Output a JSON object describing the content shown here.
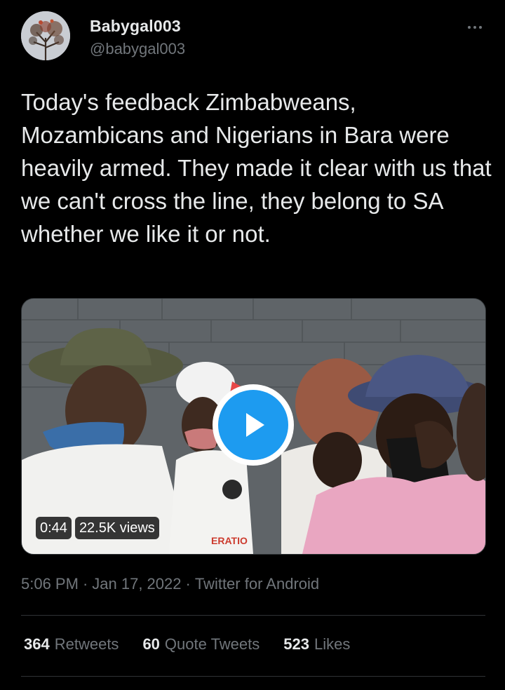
{
  "author": {
    "display_name": "Babygal003",
    "handle": "@babygal003",
    "avatar_icon": "avatar-tree-photo"
  },
  "more_icon": "ellipsis-icon",
  "tweet": {
    "text": "Today's feedback Zimbabweans, Mozambicans and Nigerians in Bara were heavily armed. They made it clear with us that we can't cross the line, they belong to SA whether we like it or not."
  },
  "video": {
    "duration": "0:44",
    "views": "22.5K views",
    "play_icon": "play-icon"
  },
  "meta": {
    "time": "5:06 PM",
    "date": "Jan 17, 2022",
    "source": "Twitter for Android",
    "separator": "·"
  },
  "stats": {
    "retweets_count": "364",
    "retweets_label": "Retweets",
    "quotes_count": "60",
    "quotes_label": "Quote Tweets",
    "likes_count": "523",
    "likes_label": "Likes"
  },
  "colors": {
    "background": "#000000",
    "text": "#e7e9ea",
    "secondary": "#71767b",
    "divider": "#2f3336",
    "accent": "#1d9bf0"
  }
}
